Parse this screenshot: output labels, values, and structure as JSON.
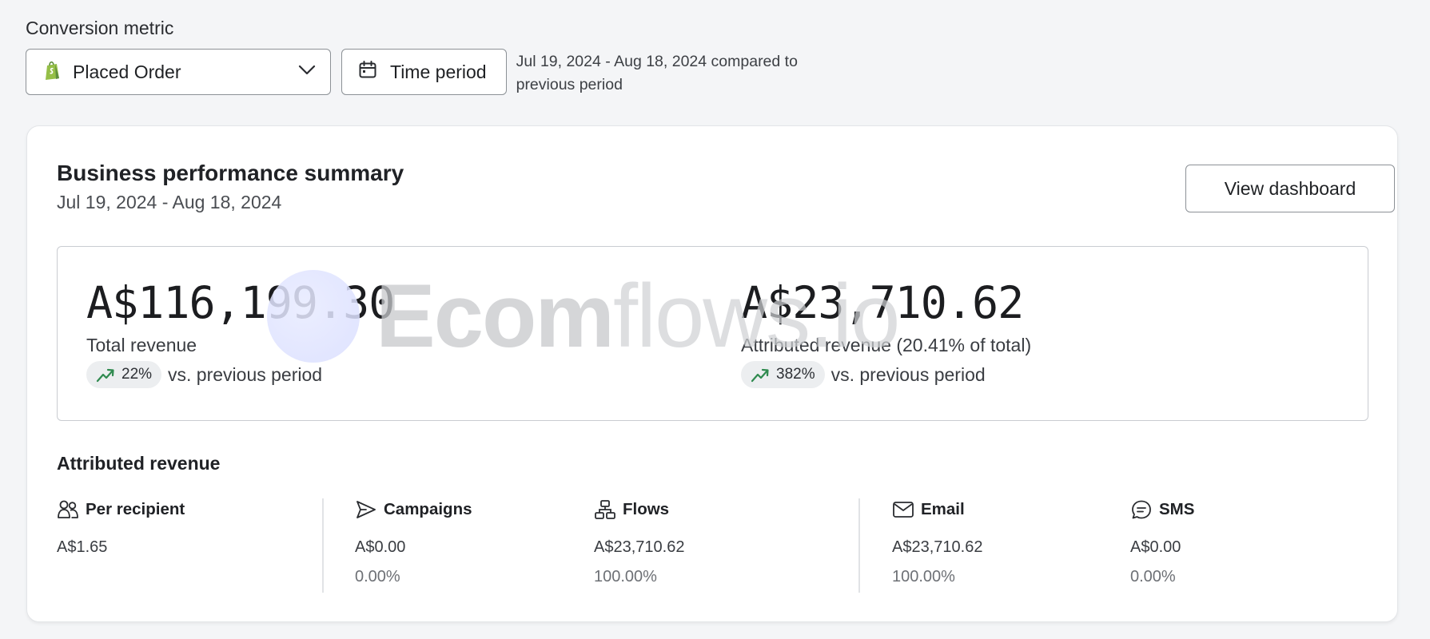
{
  "metric": {
    "label": "Conversion metric",
    "selected": "Placed Order"
  },
  "time_period": {
    "button_label": "Time period",
    "note": "Jul 19, 2024 - Aug 18, 2024 compared to previous period"
  },
  "summary": {
    "title": "Business performance summary",
    "date_range": "Jul 19, 2024 - Aug 18, 2024",
    "view_button": "View dashboard",
    "total": {
      "value": "A$116,199.30",
      "label": "Total revenue",
      "change": "22%",
      "vs": "vs. previous period"
    },
    "attributed": {
      "value": "A$23,710.62",
      "label": "Attributed revenue (20.41% of total)",
      "change": "382%",
      "vs": "vs. previous period"
    }
  },
  "watermark": {
    "strong": "Ecom",
    "light": "flows.io"
  },
  "attributed_revenue": {
    "title": "Attributed revenue",
    "columns": [
      {
        "name": "Per recipient",
        "icon": "people-icon",
        "value": "A$1.65",
        "pct": ""
      },
      {
        "name": "Campaigns",
        "icon": "send-icon",
        "value": "A$0.00",
        "pct": "0.00%"
      },
      {
        "name": "Flows",
        "icon": "flow-icon",
        "value": "A$23,710.62",
        "pct": "100.00%"
      },
      {
        "name": "Email",
        "icon": "mail-icon",
        "value": "A$23,710.62",
        "pct": "100.00%"
      },
      {
        "name": "SMS",
        "icon": "chat-icon",
        "value": "A$0.00",
        "pct": "0.00%"
      }
    ]
  },
  "colors": {
    "trend_green": "#2f8a4f",
    "shopify_green": "#95bf47"
  }
}
